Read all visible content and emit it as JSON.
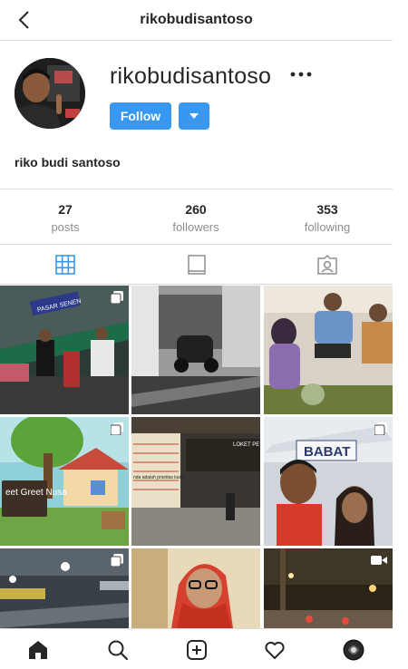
{
  "header": {
    "title": "rikobudisantoso"
  },
  "profile": {
    "username": "rikobudisantoso",
    "follow_label": "Follow",
    "full_name": "riko budi santoso"
  },
  "stats": [
    {
      "value": "27",
      "label": "posts"
    },
    {
      "value": "260",
      "label": "followers"
    },
    {
      "value": "353",
      "label": "following"
    }
  ],
  "tabs": [
    {
      "icon": "grid-icon",
      "active": true
    },
    {
      "icon": "feed-icon",
      "active": false
    },
    {
      "icon": "tagged-icon",
      "active": false
    }
  ],
  "grid_text": {
    "post1_sign": "PASAR SENEN",
    "post4_sign": "eet Greet Nusa",
    "post5_sign": "LOKET PE",
    "post5_banner": "nda adalah prioritas kami",
    "post6_sign": "BABAT"
  },
  "bottom_nav": [
    {
      "icon": "home-icon"
    },
    {
      "icon": "search-icon"
    },
    {
      "icon": "add-post-icon"
    },
    {
      "icon": "heart-icon"
    },
    {
      "icon": "profile-avatar-icon"
    }
  ],
  "colors": {
    "accent": "#3897f0",
    "border": "#dbdbdb",
    "muted": "#8e8e8e",
    "text": "#262626"
  }
}
